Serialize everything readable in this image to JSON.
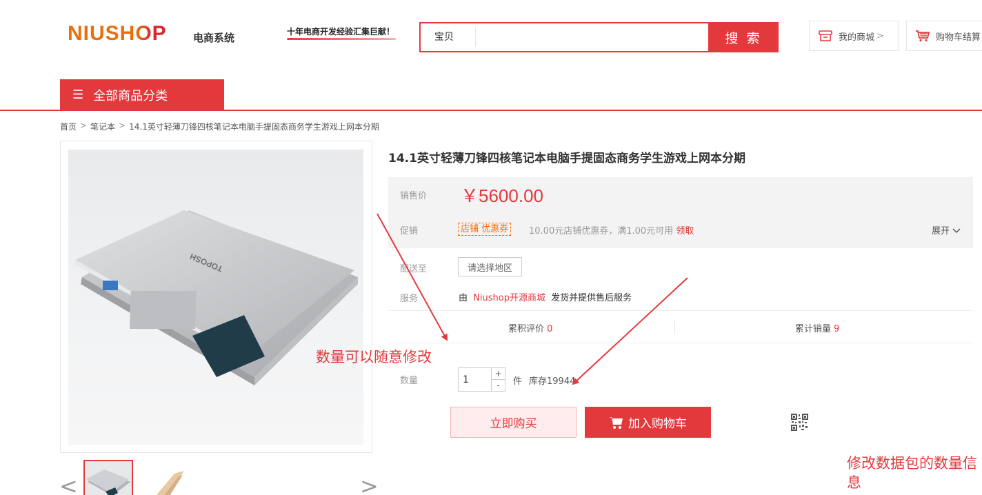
{
  "header": {
    "logo_main": "NIUSHOP",
    "logo_sub": "电商系统",
    "slogan": "十年电商开发经验汇集巨献！",
    "search_category": "宝贝",
    "search_placeholder": "",
    "search_button": "搜 索",
    "my_shop": "我的商城",
    "my_shop_arrow": ">",
    "cart": "购物车结算"
  },
  "nav": {
    "category_button": "全部商品分类"
  },
  "breadcrumb": [
    "首页",
    "笔记本",
    "14.1英寸轻薄刀锋四核笔记本电脑手提固态商务学生游戏上网本分期"
  ],
  "breadcrumb_sep": ">",
  "gallery": {
    "prev": "<",
    "next": ">",
    "laptop_brand": "TOPOSH"
  },
  "product": {
    "title": "14.1英寸轻薄刀锋四核笔记本电脑手提固态商务学生游戏上网本分期",
    "price_label": "销售价",
    "price": "￥5600.00",
    "promo_label": "促销",
    "promo_tag": "店铺 优惠券",
    "promo_text": "10.00元店铺优惠券，满1.00元可用",
    "promo_get": "领取",
    "expand": "展开",
    "ship_label": "配送至",
    "region_button": "请选择地区",
    "service_label": "服务",
    "service_prefix": "由",
    "service_shop": "Niushop开源商城",
    "service_suffix": "发货并提供售后服务",
    "eval_label": "累积评价",
    "eval_count": "0",
    "sales_label": "累计销量",
    "sales_count": "9",
    "qty_label": "数量",
    "qty_value": "1",
    "qty_plus": "+",
    "qty_minus": "-",
    "qty_unit": "件",
    "stock": "库存19944",
    "buy_now": "立即购买",
    "add_to_cart": "加入购物车"
  },
  "annotations": {
    "note1": "数量可以随意修改",
    "note2": "修改数据包的数量信息"
  },
  "colors": {
    "accent": "#e4393c",
    "logo_orange": "#e8700d",
    "promo_orange": "#ff6a00"
  },
  "icons": [
    "shop-icon",
    "cart-icon",
    "menu-icon",
    "chevron-down-icon",
    "qr-code-icon",
    "chevron-left-icon",
    "chevron-right-icon"
  ]
}
